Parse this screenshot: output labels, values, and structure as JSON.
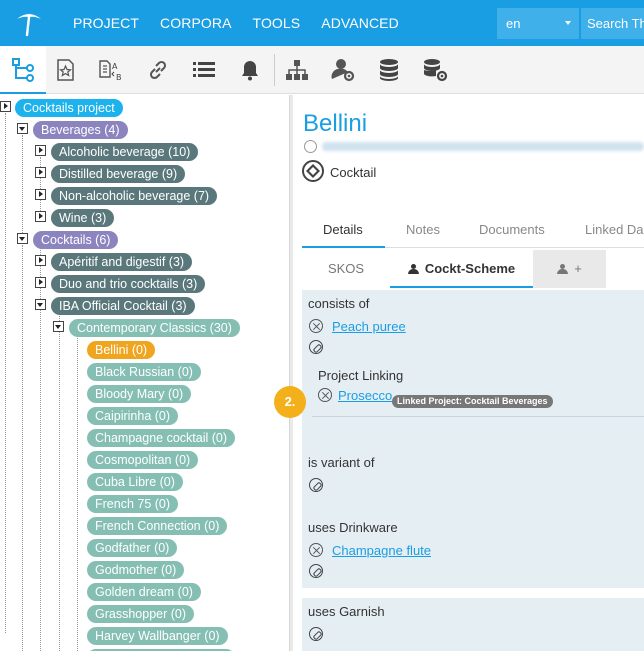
{
  "topnav": {
    "items": [
      "PROJECT",
      "CORPORA",
      "TOOLS",
      "ADVANCED"
    ],
    "language": "en",
    "search_placeholder": "Search Th"
  },
  "toolbar": {
    "icons": [
      "hierarchy-tree-icon",
      "bookmark-star-icon",
      "abc-transform-icon",
      "link-icon",
      "list-icon",
      "bell-icon",
      "org-chart-icon",
      "user-gear-icon",
      "database-icon",
      "server-gear-icon"
    ]
  },
  "tree": {
    "root": "Cocktails project",
    "beverages": "Beverages (4)",
    "alcoholic": "Alcoholic beverage (10)",
    "distilled": "Distilled beverage (9)",
    "non_alcoholic": "Non-alcoholic beverage (7)",
    "wine": "Wine (3)",
    "cocktails": "Cocktails (6)",
    "aperitif": "Apéritif and digestif (3)",
    "duo_trio": "Duo and trio cocktails (3)",
    "iba": "IBA Official Cocktail (3)",
    "contemporary": "Contemporary Classics (30)",
    "leaves": [
      "Bellini (0)",
      "Black Russian (0)",
      "Bloody Mary (0)",
      "Caipirinha (0)",
      "Champagne cocktail (0)",
      "Cosmopolitan (0)",
      "Cuba Libre (0)",
      "French 75 (0)",
      "French Connection (0)",
      "Godfather (0)",
      "Godmother (0)",
      "Golden dream (0)",
      "Grasshopper (0)",
      "Harvey Wallbanger (0)"
    ]
  },
  "detail": {
    "title": "Bellini",
    "type": "Cocktail",
    "tabs": [
      "Details",
      "Notes",
      "Documents",
      "Linked Da"
    ],
    "subtabs": [
      "SKOS",
      "Cockt-Scheme",
      "+"
    ],
    "consists_of": {
      "label": "consists of",
      "value": "Peach puree"
    },
    "project_linking": {
      "label": "Project Linking",
      "value": "Prosecco",
      "tag": "Linked Project: Cocktail Beverages",
      "step": "2."
    },
    "is_variant_of": {
      "label": "is variant of"
    },
    "uses_drinkware": {
      "label": "uses Drinkware",
      "value": "Champagne flute"
    },
    "uses_garnish": {
      "label": "uses Garnish"
    }
  },
  "colors": {
    "brand": "#1a9ee3",
    "selected": "#f0a51f",
    "badge": "#f3b01b"
  }
}
